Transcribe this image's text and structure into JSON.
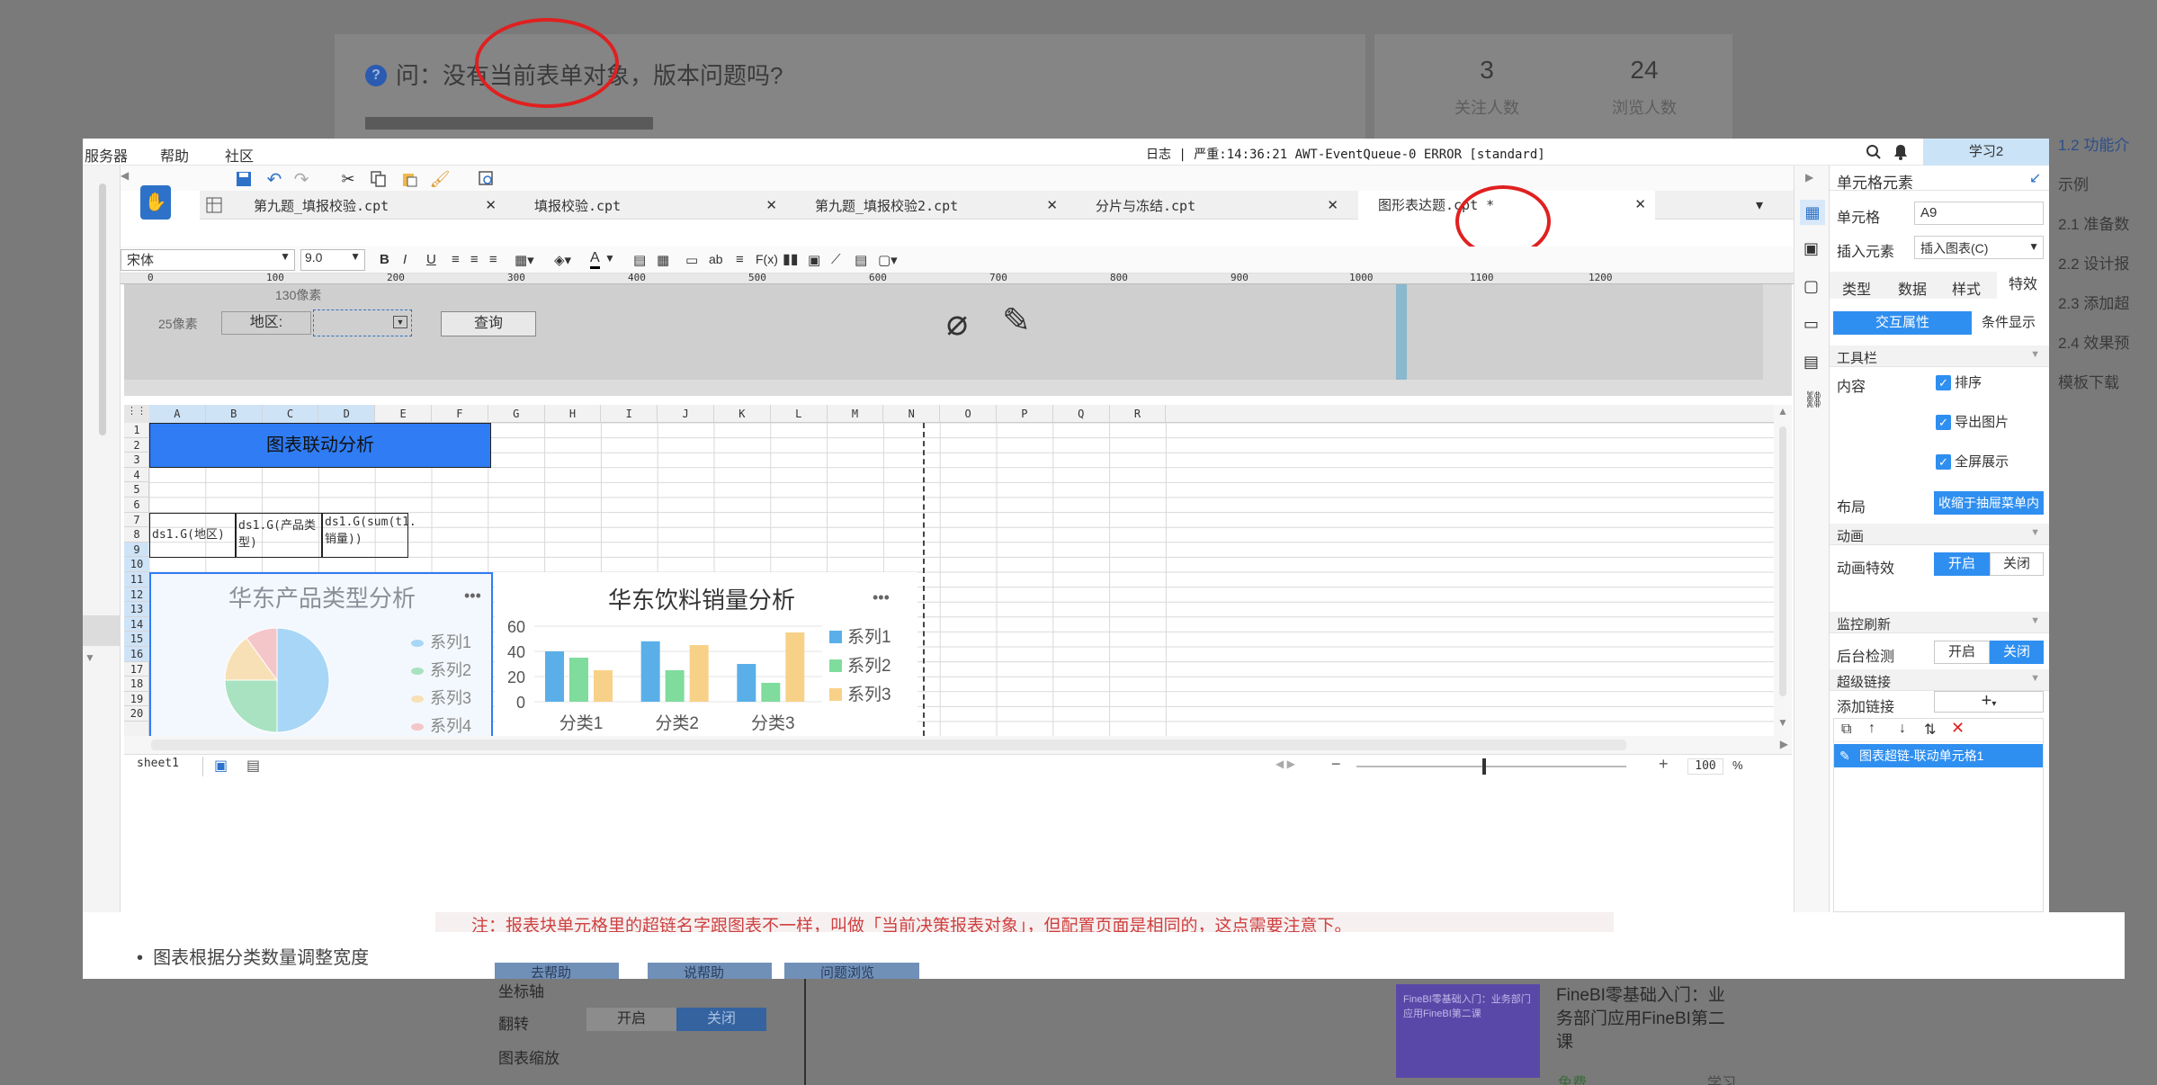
{
  "background": {
    "question": "问：没有当前表单对象，版本问题吗?",
    "stats": [
      {
        "value": "3",
        "label": "关注人数"
      },
      {
        "value": "24",
        "label": "浏览人数"
      }
    ],
    "toc": [
      "1.2 功能介",
      "示例",
      "2.1 准备数",
      "2.2 设计报",
      "2.3 添加超",
      "2.4 效果预",
      "模板下载"
    ],
    "note": "注：报表块单元格里的超链名字跟图表不一样，叫做「当前决策报表对象」，但配置页面是相同的，这点需要注意下。",
    "bullet": "图表根据分类数量调整宽度",
    "bottom_rows": [
      {
        "label": "坐标轴"
      },
      {
        "label": "翻转",
        "on": "开启",
        "off": "关闭"
      },
      {
        "label": "图表缩放"
      }
    ],
    "bottom_buttons": [
      "去帮助",
      "说帮助",
      "问题浏览"
    ],
    "course": {
      "title": "FineBI零基础入门：业务部门应用FineBI第二课",
      "price": "免费",
      "tag": "学习",
      "thumb": "FineBI零基础入门：业务部门应用FineBI第二课"
    }
  },
  "menubar": {
    "items": [
      "服务器",
      "帮助",
      "社区"
    ],
    "log": "日志 | 严重:14:36:21 AWT-EventQueue-0 ERROR [standard]",
    "user": "学习2"
  },
  "tabs": [
    "第九题_填报校验.cpt",
    "填报校验.cpt",
    "第九题_填报校验2.cpt",
    "分片与冻结.cpt",
    "图形表达题.cpt *"
  ],
  "format": {
    "font": "宋体",
    "size": "9.0",
    "bold": "B",
    "italic": "I",
    "underline": "U",
    "ab": "ab",
    "fx": "F(x)"
  },
  "ruler": [
    "0",
    "100",
    "200",
    "300",
    "400",
    "500",
    "600",
    "700",
    "800",
    "900",
    "1000",
    "1100",
    "1200"
  ],
  "param_panel": {
    "dim1": "130像素",
    "dim2": "25像素",
    "label": "地区:",
    "query": "查询"
  },
  "sheet": {
    "cols": [
      "A",
      "B",
      "C",
      "D",
      "E",
      "F",
      "G",
      "H",
      "I",
      "J",
      "K",
      "L",
      "M",
      "N",
      "O",
      "P",
      "Q",
      "R"
    ],
    "rows": [
      "1",
      "2",
      "3",
      "4",
      "5",
      "6",
      "7",
      "8",
      "9",
      "10",
      "11",
      "12",
      "13",
      "14",
      "15",
      "16",
      "17",
      "18",
      "19",
      "20"
    ],
    "title_cell": "图表联动分析",
    "cellA5": "ds1.G(地区)",
    "cellB5": "ds1.G(产品类型)",
    "cellC5": "ds1.G(sum(t1.销量))",
    "tab": "sheet1",
    "zoom": "100",
    "zoom_unit": "%"
  },
  "chart_data": [
    {
      "type": "pie",
      "title": "华东产品类型分析",
      "categories": [
        "系列1",
        "系列2",
        "系列3",
        "系列4"
      ],
      "values": [
        50,
        25,
        15,
        10
      ],
      "colors": [
        "#a8d6f6",
        "#a9e2c0",
        "#f7e0b5",
        "#f5c6c9"
      ]
    },
    {
      "type": "bar",
      "title": "华东饮料销量分析",
      "categories": [
        "分类1",
        "分类2",
        "分类3"
      ],
      "series": [
        {
          "name": "系列1",
          "values": [
            40,
            48,
            30
          ],
          "color": "#5aafe8"
        },
        {
          "name": "系列2",
          "values": [
            35,
            25,
            15
          ],
          "color": "#7fdc9c"
        },
        {
          "name": "系列3",
          "values": [
            25,
            45,
            55
          ],
          "color": "#f8d189"
        }
      ],
      "ylim": [
        0,
        60
      ],
      "yticks": [
        "0",
        "20",
        "40",
        "60"
      ]
    }
  ],
  "right_panel": {
    "header": "单元格元素",
    "cell_label": "单元格",
    "cell_value": "A9",
    "insert_label": "插入元素",
    "insert_value": "插入图表(C)",
    "tabs": [
      "类型",
      "数据",
      "样式",
      "特效"
    ],
    "subtabs": [
      "交互属性",
      "条件显示"
    ],
    "toolbar_section": "工具栏",
    "content_label": "内容",
    "checks": [
      "排序",
      "导出图片",
      "全屏展示"
    ],
    "layout_label": "布局",
    "layout_value": "收缩于抽屉菜单内",
    "anim_section": "动画",
    "anim_label": "动画特效",
    "on": "开启",
    "off": "关闭",
    "monitor_section": "监控刷新",
    "bg_label": "后台检测",
    "link_section": "超级链接",
    "add_link": "添加链接",
    "add_symbol": "+",
    "link_item": "图表超链-联动单元格1"
  }
}
